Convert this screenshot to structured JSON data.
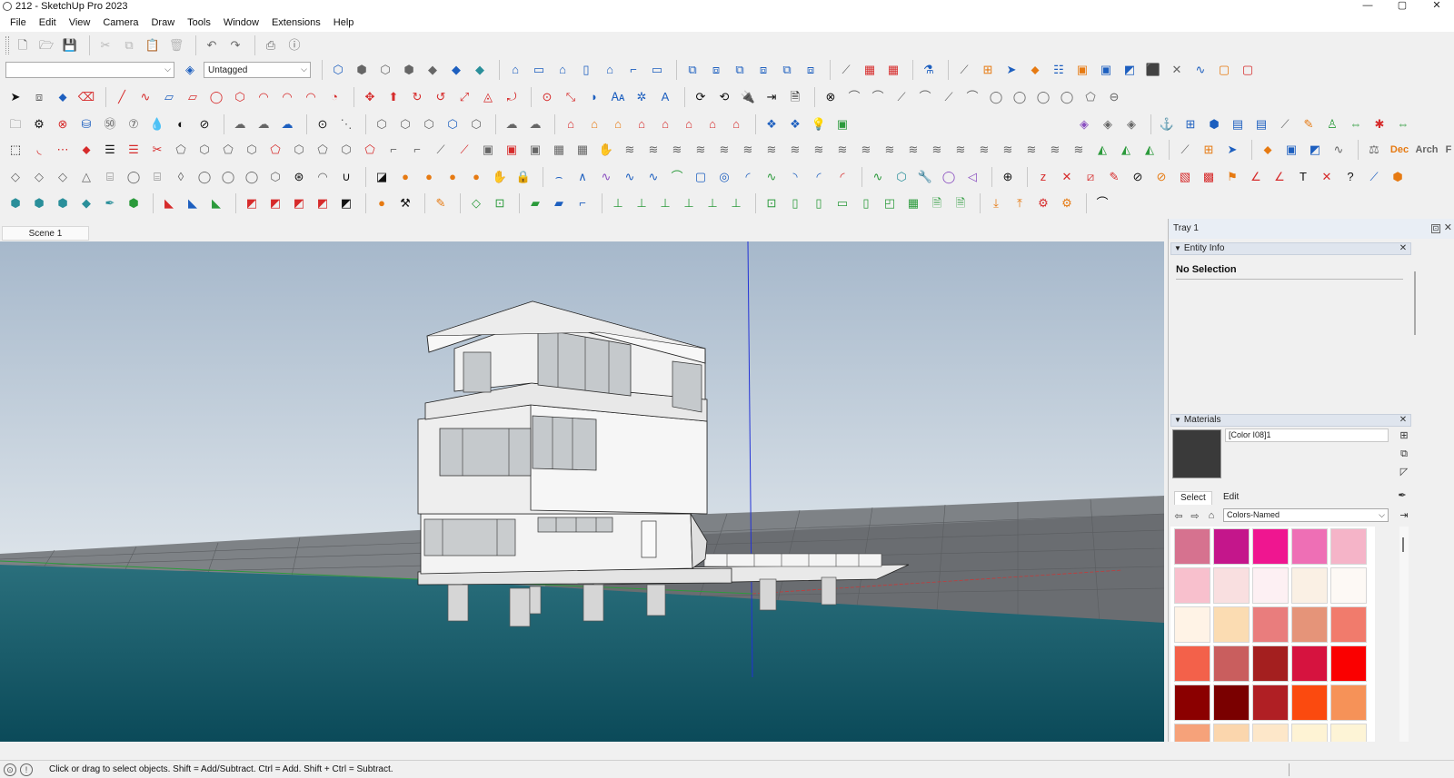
{
  "window": {
    "title": "212 - SketchUp Pro 2023",
    "minimize": "—",
    "maximize": "▢",
    "close": "✕"
  },
  "menu": [
    "File",
    "Edit",
    "View",
    "Camera",
    "Draw",
    "Tools",
    "Window",
    "Extensions",
    "Help"
  ],
  "toolbar": {
    "layer_value": "",
    "tag_value": "Untagged",
    "extra_labels": {
      "dec": "Dec",
      "arch": "Arch",
      "f": "F"
    }
  },
  "scenes": [
    "Scene 1"
  ],
  "tray": {
    "title": "Tray 1",
    "pin": "⊡",
    "close": "✕",
    "entity_info": {
      "title": "Entity Info",
      "status": "No Selection"
    },
    "materials": {
      "title": "Materials",
      "current_name": "[Color I08]1",
      "current_color": "#3a3a3a",
      "tabs": [
        "Select",
        "Edit"
      ],
      "collection": "Colors-Named",
      "swatches": [
        "#d6728f",
        "#c4168b",
        "#ef1690",
        "#ee6fb5",
        "#f5b4c8",
        "#f8c0cd",
        "#f9dfe0",
        "#fdf0f3",
        "#faf0e4",
        "#fdf9f5",
        "#fff3e6",
        "#fbdcb2",
        "#e97d7d",
        "#e59479",
        "#f17b6c",
        "#f3614a",
        "#c95e5e",
        "#a41f1f",
        "#d6133f",
        "#fa0000",
        "#8b0000",
        "#7a0000",
        "#b01f24",
        "#fb4a0f",
        "#f69258",
        "#f6a27a",
        "#fbd6ad",
        "#fde7c9",
        "#fef3d4",
        "#fdf4d6"
      ]
    }
  },
  "status": {
    "message": "Click or drag to select objects. Shift = Add/Subtract. Ctrl = Add. Shift + Ctrl = Subtract."
  }
}
